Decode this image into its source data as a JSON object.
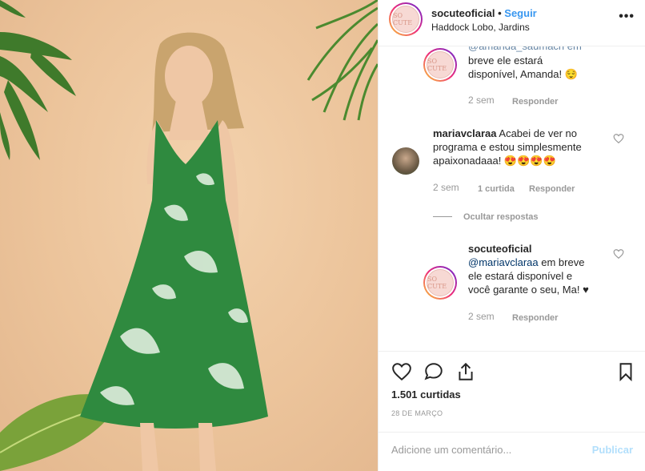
{
  "post": {
    "username": "socuteoficial",
    "dot": "•",
    "follow_label": "Seguir",
    "location": "Haddock Lobo, Jardins",
    "more_label": "•••",
    "avatar_logo_text": "SO CUTE"
  },
  "comments": [
    {
      "partial_top": "@amanda_saumach em",
      "text_line1": "breve ele estará",
      "text_line2": "disponível, Amanda! 😌",
      "time": "2 sem",
      "reply_label": "Responder"
    },
    {
      "username": "mariavclaraa",
      "text_line1": " Acabei de ver no",
      "text_line2": "programa e estou simplesmente",
      "text_line3": "apaixonadaaa! 😍😍😍😍",
      "time": "2 sem",
      "likes": "1 curtida",
      "reply_label": "Responder"
    },
    {
      "hide_replies_label": "Ocultar respostas"
    },
    {
      "username": "socuteoficial",
      "mention": "@mariavclaraa",
      "text_line1": " em breve",
      "text_line2": "ele estará disponível e",
      "text_line3": "você garante o seu, Ma! ♥",
      "time": "2 sem",
      "reply_label": "Responder"
    }
  ],
  "actions": {
    "likes_count": "1.501 curtidas",
    "date": "28 DE MARÇO",
    "add_comment_placeholder": "Adicione um comentário...",
    "publish_label": "Publicar"
  },
  "icons": [
    "heart-icon",
    "comment-icon",
    "share-icon",
    "bookmark-icon",
    "more-icon"
  ],
  "colors": {
    "link": "#3897f0",
    "muted": "#999999",
    "publish_disabled": "#b2dffc",
    "photo_bg": "#ecc49b"
  }
}
